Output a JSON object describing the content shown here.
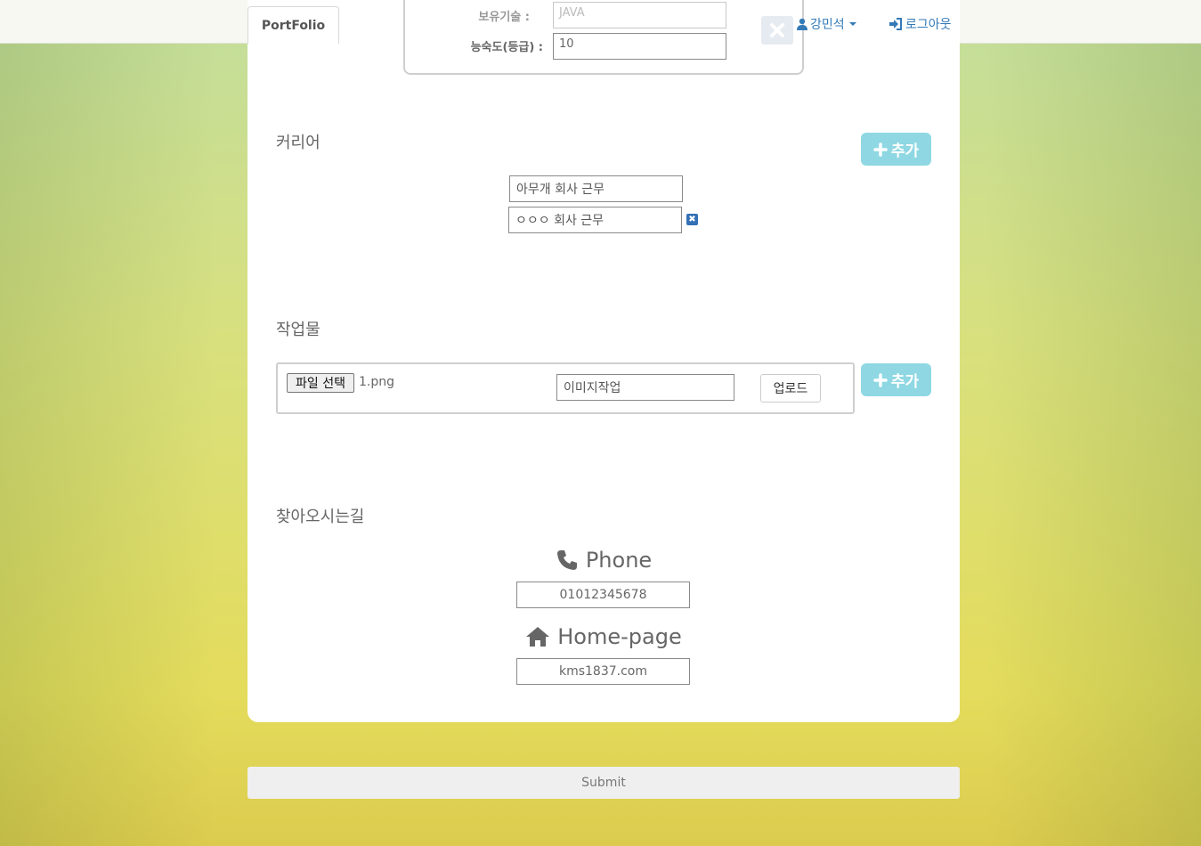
{
  "app": {
    "brand": "PortFolio"
  },
  "header": {
    "user_name": "강민석",
    "logout_label": "로그아웃"
  },
  "skills": {
    "skill_label": "보유기술 :",
    "skill_value": "JAVA",
    "level_label": "능숙도(등급) :",
    "level_value": "10"
  },
  "career": {
    "title": "커리어",
    "add_label": "추가",
    "items": [
      "아무개 회사 근무",
      "ㅇㅇㅇ 회사 근무"
    ]
  },
  "works": {
    "title": "작업물",
    "file_button_label": "파일 선택",
    "file_name": "1.png",
    "description_value": "이미지작업",
    "upload_label": "업로드",
    "add_label": "추가"
  },
  "directions": {
    "title": "찾아오시는길",
    "phone_label": "Phone",
    "phone_value": "01012345678",
    "homepage_label": "Home-page",
    "homepage_value": "kms1837.com"
  },
  "form": {
    "submit_label": "Submit"
  },
  "colors": {
    "accent_button": "#8fd8e3",
    "link": "#337ab7",
    "delete_icon": "#3470b5"
  },
  "icons": {
    "close": "close-icon",
    "user": "user-icon",
    "logout": "logout-icon",
    "plus": "plus-icon",
    "delete": "remove-icon",
    "phone": "phone-icon",
    "home": "home-icon"
  }
}
